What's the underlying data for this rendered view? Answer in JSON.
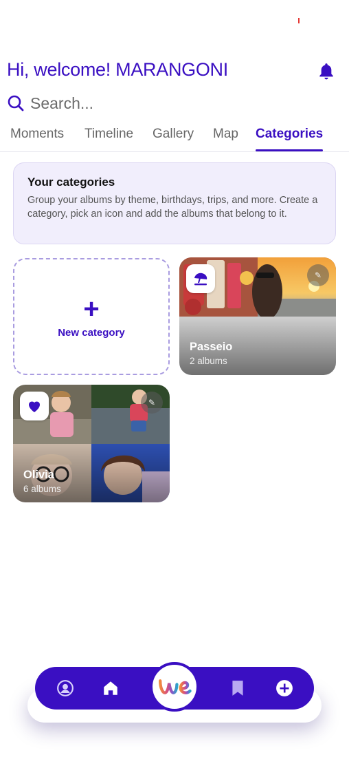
{
  "header": {
    "greeting": "Hi, welcome! MARANGONI"
  },
  "search": {
    "placeholder": "Search..."
  },
  "tabs": [
    {
      "label": "Moments",
      "active": false
    },
    {
      "label": "Timeline",
      "active": false
    },
    {
      "label": "Gallery",
      "active": false
    },
    {
      "label": "Map",
      "active": false
    },
    {
      "label": "Categories",
      "active": true
    }
  ],
  "info": {
    "title": "Your categories",
    "text": "Group your albums by theme, birthdays, trips, and more. Create a category, pick an icon and add the albums that belong to it."
  },
  "new_category": {
    "plus": "+",
    "label": "New category"
  },
  "categories": [
    {
      "name": "Passeio",
      "count": "2 albums",
      "icon": "beach-umbrella-icon"
    },
    {
      "name": "Olivia",
      "count": "6 albums",
      "icon": "heart-icon"
    }
  ],
  "bottom_nav": {
    "items": [
      "profile-icon",
      "home-icon",
      "we-logo",
      "bookmark-icon",
      "add-icon"
    ]
  },
  "colors": {
    "accent": "#3a0fc2",
    "info_bg": "#f1eefc",
    "dashed_border": "#a99ce0"
  }
}
